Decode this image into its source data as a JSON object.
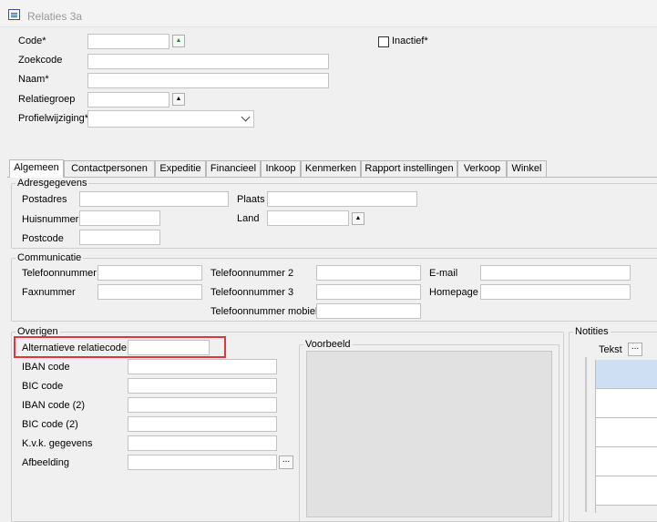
{
  "window": {
    "title": "Relaties 3a"
  },
  "header": {
    "code_label": "Code*",
    "code_value": "",
    "zoekcode_label": "Zoekcode",
    "zoekcode_value": "",
    "naam_label": "Naam*",
    "naam_value": "",
    "relatiegroep_label": "Relatiegroep",
    "relatiegroep_value": "",
    "profielwijziging_label": "Profielwijziging*",
    "profielwijziging_value": "",
    "inactief_label": "Inactief*",
    "inactief_checked": false
  },
  "tabs": [
    {
      "label": "Algemeen",
      "active": true
    },
    {
      "label": "Contactpersonen"
    },
    {
      "label": "Expeditie"
    },
    {
      "label": "Financieel"
    },
    {
      "label": "Inkoop"
    },
    {
      "label": "Kenmerken"
    },
    {
      "label": "Rapport instellingen"
    },
    {
      "label": "Verkoop"
    },
    {
      "label": "Winkel"
    }
  ],
  "adresgegevens": {
    "title": "Adresgegevens",
    "postadres_label": "Postadres",
    "huisnummer_label": "Huisnummer",
    "postcode_label": "Postcode",
    "plaats_label": "Plaats",
    "land_label": "Land"
  },
  "communicatie": {
    "title": "Communicatie",
    "telefoon_label": "Telefoonnummer",
    "fax_label": "Faxnummer",
    "telefoon2_label": "Telefoonnummer 2",
    "telefoon3_label": "Telefoonnummer 3",
    "mobiel_label": "Telefoonnummer mobiel",
    "email_label": "E-mail",
    "homepage_label": "Homepage"
  },
  "overigen": {
    "title": "Overigen",
    "alt_code_label": "Alternatieve relatiecode",
    "iban_label": "IBAN code",
    "bic_label": "BIC code",
    "iban2_label": "IBAN code (2)",
    "bic2_label": "BIC code (2)",
    "kvk_label": "K.v.k. gegevens",
    "afbeelding_label": "Afbeelding",
    "voorbeeld_title": "Voorbeeld"
  },
  "notities": {
    "title": "Notities",
    "tekst_label": "Tekst",
    "ellipsis": "..."
  },
  "colors": {
    "highlight": "#e2363c",
    "selected_row": "#cfdff3",
    "spin_green": "#1c8a2e"
  }
}
